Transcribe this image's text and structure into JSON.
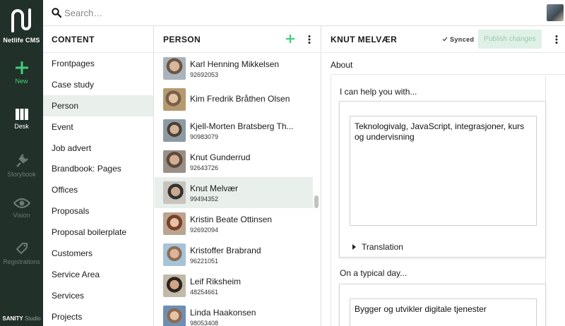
{
  "app": {
    "name": "Netlife CMS",
    "brand_color": "#22302a",
    "accent_color": "#3fcf7a"
  },
  "rail": {
    "items": [
      {
        "label": "New",
        "icon": "plus-icon"
      },
      {
        "label": "Desk",
        "icon": "desk-icon"
      },
      {
        "label": "Storybook",
        "icon": "plug-icon"
      },
      {
        "label": "Vision",
        "icon": "eye-icon"
      },
      {
        "label": "Registrations",
        "icon": "tag-icon"
      }
    ],
    "footer_brand": "SANITY",
    "footer_suffix": "Studio"
  },
  "search": {
    "placeholder": "Search…",
    "icon": "search-icon"
  },
  "content_pane": {
    "title": "CONTENT",
    "items": [
      "Frontpages",
      "Case study",
      "Person",
      "Event",
      "Job advert",
      "Brandbook: Pages",
      "Offices",
      "Proposals",
      "Proposal boilerplate",
      "Customers",
      "Service Area",
      "Services",
      "Projects"
    ],
    "selected": "Person"
  },
  "person_pane": {
    "title": "PERSON",
    "people": [
      {
        "name": "Karl Henning Mikkelsen",
        "phone": "92692053"
      },
      {
        "name": "Kim Fredrik Bråthen Olsen",
        "phone": ""
      },
      {
        "name": "Kjell-Morten Bratsberg Th...",
        "phone": "90983079"
      },
      {
        "name": "Knut Gunderrud",
        "phone": "92643726"
      },
      {
        "name": "Knut Melvær",
        "phone": "99494352"
      },
      {
        "name": "Kristin Beate Ottinsen",
        "phone": "92692094"
      },
      {
        "name": "Kristoffer Brabrand",
        "phone": "96221051"
      },
      {
        "name": "Leif Riksheim",
        "phone": "48254661"
      },
      {
        "name": "Linda Haakonsen",
        "phone": "98053408"
      }
    ],
    "selected": "Knut Melvær"
  },
  "document": {
    "title": "KNUT MELVÆR",
    "status": "Synced",
    "publish_label": "Publish changes",
    "section_label": "About",
    "field1_label": "I can help you with...",
    "field1_value": "Teknologivalg, JavaScript, integrasjoner, kurs og undervisning",
    "translation_label": "Translation",
    "field2_label": "On a typical day...",
    "field2_value": "Bygger og utvikler digitale tjenester"
  }
}
